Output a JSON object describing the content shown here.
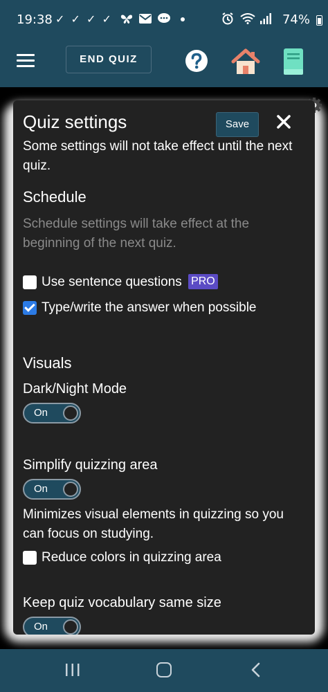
{
  "status_bar": {
    "time": "19:38",
    "notification_icons": "✓ ✓ ✓ ✓",
    "battery": "74%"
  },
  "app_bar": {
    "end_quiz_label": "END QUIZ"
  },
  "modal": {
    "title": "Quiz settings",
    "save_label": "Save",
    "note": "Some settings will not take effect until the next quiz.",
    "schedule": {
      "heading": "Schedule",
      "description": "Schedule settings will take effect at the beginning of the next quiz.",
      "options": [
        {
          "label": "Use sentence questions",
          "checked": false,
          "badge": "PRO"
        },
        {
          "label": "Type/write the answer when possible",
          "checked": true
        }
      ]
    },
    "visuals": {
      "heading": "Visuals",
      "dark_mode": {
        "label": "Dark/Night Mode",
        "state": "On"
      },
      "simplify": {
        "label": "Simplify quizzing area",
        "state": "On",
        "description": "Minimizes visual elements in quizzing so you can focus on studying."
      },
      "reduce_colors": {
        "label": "Reduce colors in quizzing area",
        "checked": false
      },
      "keep_size": {
        "label": "Keep quiz vocabulary same size",
        "state": "On"
      }
    }
  },
  "colors": {
    "bar": "#1f4a5e",
    "modal_bg": "#222222",
    "accent_check": "#2c7be5",
    "pro_badge": "#5b4bc4"
  }
}
